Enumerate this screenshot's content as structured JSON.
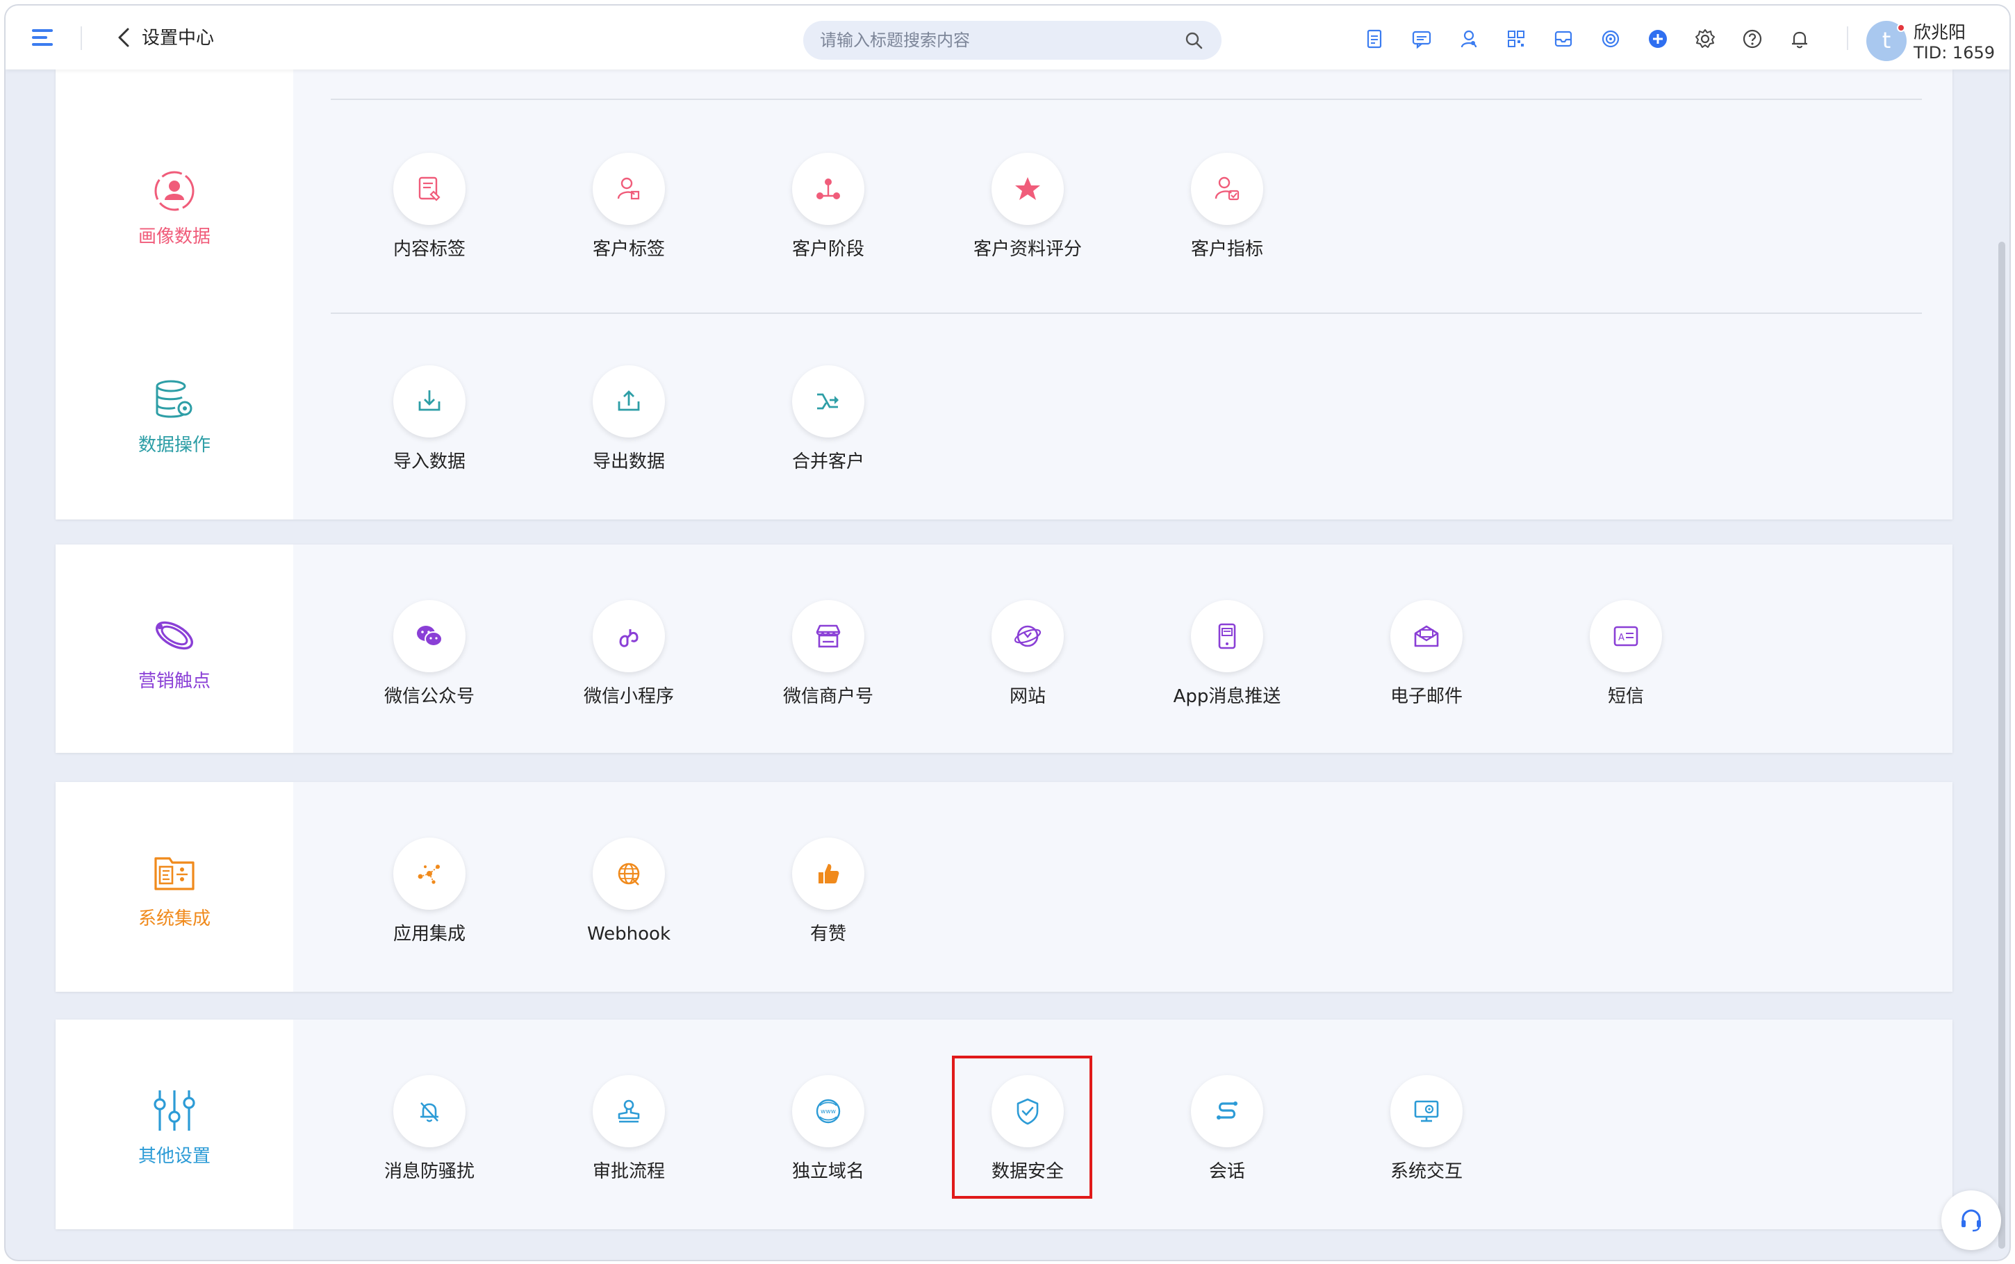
{
  "header": {
    "title": "设置中心",
    "search_placeholder": "请输入标题搜索内容",
    "user_name": "欣兆阳",
    "tid": "TID: 1659",
    "avatar_letter": "t",
    "tools": [
      "document-icon",
      "message-icon",
      "customer-service-icon",
      "qrcode-icon",
      "inbox-icon",
      "target-icon",
      "add-icon",
      "gear-icon",
      "help-icon",
      "bell-icon"
    ]
  },
  "colors": {
    "accent": "#3b7cf0",
    "profile": "#f05c7a",
    "data_ops": "#2d9ea6",
    "marketing": "#8a3fd6",
    "integration": "#f08a1c",
    "other": "#2c9bd6",
    "highlight": "#e01a1a"
  },
  "sections": {
    "profile": {
      "label": "画像数据",
      "icon": "user-circle-icon",
      "items": [
        {
          "label": "内容标签",
          "icon": "content-tag-icon"
        },
        {
          "label": "客户标签",
          "icon": "customer-tag-icon"
        },
        {
          "label": "客户阶段",
          "icon": "customer-stage-icon"
        },
        {
          "label": "客户资料评分",
          "icon": "star-icon"
        },
        {
          "label": "客户指标",
          "icon": "customer-metric-icon"
        }
      ]
    },
    "data_ops": {
      "label": "数据操作",
      "icon": "database-gear-icon",
      "items": [
        {
          "label": "导入数据",
          "icon": "import-icon"
        },
        {
          "label": "导出数据",
          "icon": "export-icon"
        },
        {
          "label": "合并客户",
          "icon": "merge-icon"
        }
      ]
    },
    "marketing": {
      "label": "营销触点",
      "icon": "orbit-icon",
      "items": [
        {
          "label": "微信公众号",
          "icon": "wechat-icon"
        },
        {
          "label": "微信小程序",
          "icon": "miniprogram-icon"
        },
        {
          "label": "微信商户号",
          "icon": "store-icon"
        },
        {
          "label": "网站",
          "icon": "website-icon"
        },
        {
          "label": "App消息推送",
          "icon": "app-push-icon"
        },
        {
          "label": "电子邮件",
          "icon": "email-icon"
        },
        {
          "label": "短信",
          "icon": "sms-icon"
        }
      ]
    },
    "integration": {
      "label": "系统集成",
      "icon": "integration-icon",
      "items": [
        {
          "label": "应用集成",
          "icon": "app-integration-icon"
        },
        {
          "label": "Webhook",
          "icon": "webhook-icon"
        },
        {
          "label": "有赞",
          "icon": "thumbs-up-icon"
        }
      ]
    },
    "other": {
      "label": "其他设置",
      "icon": "sliders-icon",
      "items": [
        {
          "label": "消息防骚扰",
          "icon": "bell-off-icon"
        },
        {
          "label": "审批流程",
          "icon": "stamp-icon"
        },
        {
          "label": "独立域名",
          "icon": "www-icon"
        },
        {
          "label": "数据安全",
          "icon": "shield-icon"
        },
        {
          "label": "会话",
          "icon": "session-icon"
        },
        {
          "label": "系统交互",
          "icon": "monitor-gear-icon"
        }
      ]
    }
  }
}
